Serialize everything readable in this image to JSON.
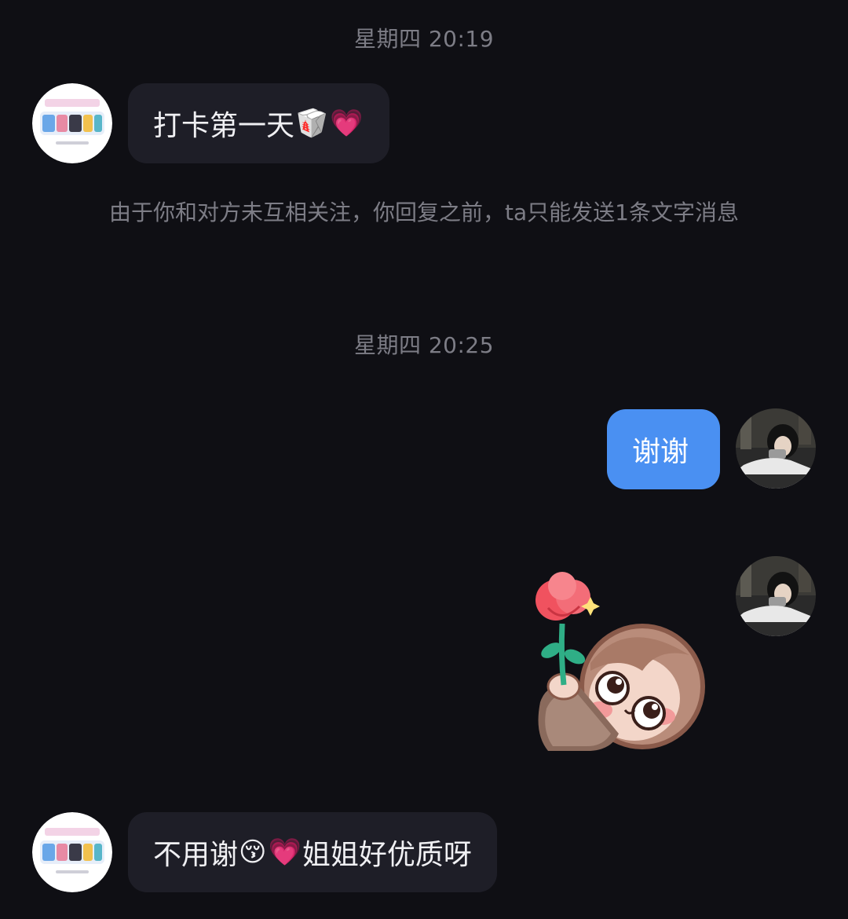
{
  "chat": {
    "timestamp_1": "星期四 20:19",
    "timestamp_2": "星期四 20:25",
    "system_notice": "由于你和对方未互相关注，你回复之前，ta只能发送1条文字消息",
    "messages": [
      {
        "sender": "other",
        "text": "打卡第一天",
        "emojis": [
          "🥡",
          "💗"
        ]
      },
      {
        "sender": "me",
        "text": "谢谢"
      },
      {
        "sender": "me",
        "sticker": "girl-holding-rose-sticker"
      },
      {
        "sender": "other",
        "text_before": "不用谢",
        "emojis": [
          "😚",
          "💗"
        ],
        "text_after": "姐姐好优质呀"
      }
    ]
  },
  "colors": {
    "background": "#0f0f14",
    "incoming_bubble": "#1e1e27",
    "outgoing_bubble": "#4a90f2",
    "meta_text": "#7d7d86"
  },
  "icons": {
    "other_avatar": "collage-avatar-icon",
    "my_avatar": "photo-avatar-icon"
  }
}
